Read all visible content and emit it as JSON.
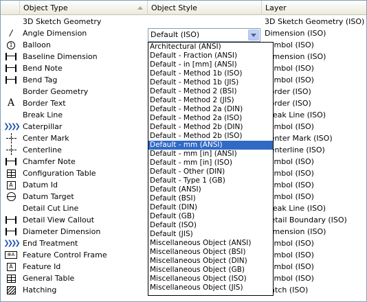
{
  "columns": {
    "object_type": "Object Type",
    "object_style": "Object Style",
    "layer": "Layer"
  },
  "rows": [
    {
      "type": "3D Sketch Geometry",
      "layer": "3D Sketch Geometry (ISO)",
      "icon": "none"
    },
    {
      "type": "Angle Dimension",
      "layer": "Dimension (ISO)",
      "icon": "angle-dimension-icon"
    },
    {
      "type": "Balloon",
      "layer": "Symbol (ISO)",
      "icon": "balloon-icon"
    },
    {
      "type": "Baseline Dimension",
      "layer": "Dimension (ISO)",
      "icon": "dimension-icon"
    },
    {
      "type": "Bend Note",
      "layer": "Symbol (ISO)",
      "icon": "dimension-icon"
    },
    {
      "type": "Bend Tag",
      "layer": "Symbol (ISO)",
      "icon": "dimension-icon"
    },
    {
      "type": "Border Geometry",
      "layer": "Border (ISO)",
      "icon": "none"
    },
    {
      "type": "Border Text",
      "layer": "Border (ISO)",
      "icon": "text-icon"
    },
    {
      "type": "Break Line",
      "layer": "Break Line (ISO)",
      "icon": "none"
    },
    {
      "type": "Caterpillar",
      "layer": "Symbol (ISO)",
      "icon": "caterpillar-icon"
    },
    {
      "type": "Center Mark",
      "layer": "Center Mark (ISO)",
      "icon": "center-mark-icon"
    },
    {
      "type": "Centerline",
      "layer": "Centerline (ISO)",
      "icon": "centerline-icon"
    },
    {
      "type": "Chamfer Note",
      "layer": "Symbol (ISO)",
      "icon": "dimension-icon"
    },
    {
      "type": "Configuration Table",
      "layer": "Symbol (ISO)",
      "icon": "table-icon"
    },
    {
      "type": "Datum Id",
      "layer": "Symbol (ISO)",
      "icon": "datum-id-icon"
    },
    {
      "type": "Datum Target",
      "layer": "Symbol (ISO)",
      "icon": "datum-target-icon"
    },
    {
      "type": "Detail Cut Line",
      "layer": "Break Line (ISO)",
      "icon": "none"
    },
    {
      "type": "Detail View Callout",
      "layer": "Detail Boundary (ISO)",
      "icon": "dimension-icon"
    },
    {
      "type": "Diameter Dimension",
      "layer": "Dimension (ISO)",
      "icon": "dimension-icon"
    },
    {
      "type": "End Treatment",
      "layer": "Symbol (ISO)",
      "icon": "caterpillar-icon"
    },
    {
      "type": "Feature Control Frame",
      "layer": "Symbol (ISO)",
      "icon": "feature-control-frame-icon"
    },
    {
      "type": "Feature Id",
      "layer": "Symbol (ISO)",
      "icon": "datum-id-icon"
    },
    {
      "type": "General Table",
      "layer": "Symbol (ISO)",
      "icon": "table-icon"
    },
    {
      "type": "Hatching",
      "layer": "Hatch (ISO)",
      "icon": "hatch-icon"
    }
  ],
  "combo": {
    "value": "Default (ISO)"
  },
  "dropdown": {
    "selected_index": 11,
    "options": [
      "Architectural (ANSI)",
      "Default - Fraction (ANSI)",
      "Default - in [mm] (ANSI)",
      "Default - Method 1b (ISO)",
      "Default - Method 1b (JIS)",
      "Default - Method 2 (BSI)",
      "Default - Method 2 (JIS)",
      "Default - Method 2a (DIN)",
      "Default - Method 2a (ISO)",
      "Default - Method 2b (DIN)",
      "Default - Method 2b (ISO)",
      "Default - mm (ANSI)",
      "Default - mm [in] (ANSI)",
      "Default - mm [in] (ISO)",
      "Default - Other (DIN)",
      "Default - Type 1 (GB)",
      "Default (ANSI)",
      "Default (BSI)",
      "Default (DIN)",
      "Default (GB)",
      "Default (ISO)",
      "Default (JIS)",
      "Miscellaneous Object (ANSI)",
      "Miscellaneous Object (BSI)",
      "Miscellaneous Object (DIN)",
      "Miscellaneous Object (GB)",
      "Miscellaneous Object (ISO)",
      "Miscellaneous Object (JIS)"
    ]
  },
  "colors": {
    "selection": "#316ac5",
    "header_bg": "#ebeadb",
    "border": "#7f9db9"
  }
}
